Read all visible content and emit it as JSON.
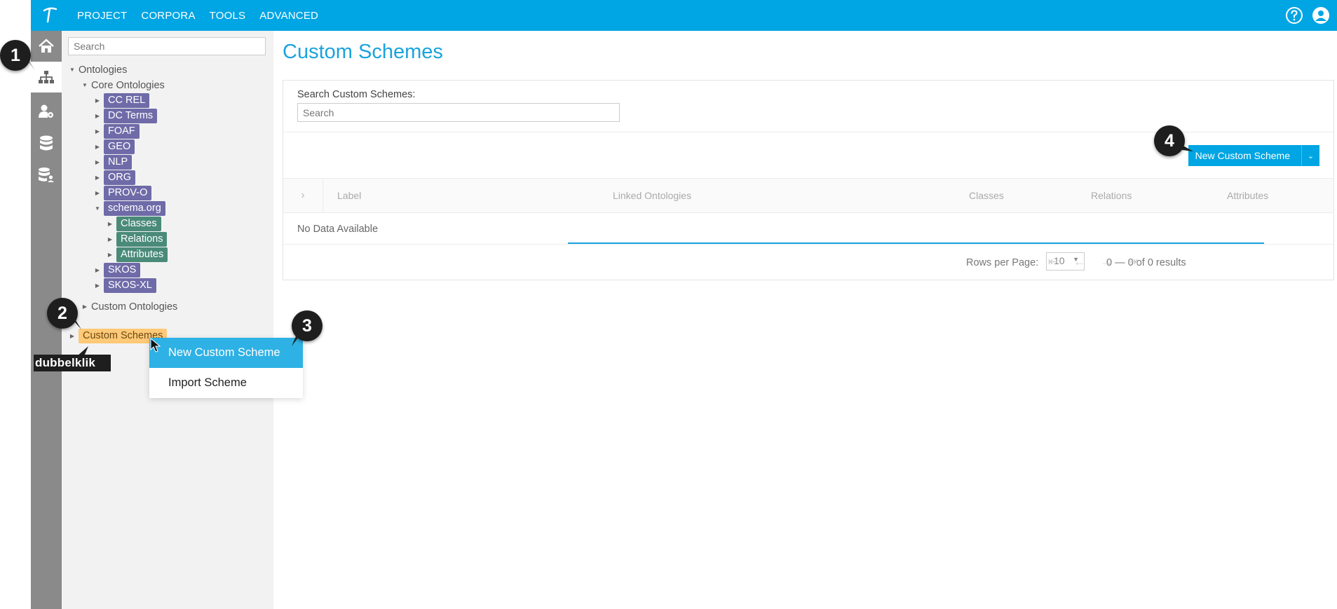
{
  "topbar": {
    "nav": [
      "PROJECT",
      "CORPORA",
      "TOOLS",
      "ADVANCED"
    ],
    "brand_color": "#00a5e3"
  },
  "sidebar": {
    "search_placeholder": "Search",
    "tree": {
      "ontologies": "Ontologies",
      "core_ontologies": "Core Ontologies",
      "core_items": [
        "CC REL",
        "DC Terms",
        "FOAF",
        "GEO",
        "NLP",
        "ORG",
        "PROV-O",
        "schema.org"
      ],
      "schema_children": [
        "Classes",
        "Relations",
        "Attributes"
      ],
      "more_items": [
        "SKOS",
        "SKOS-XL"
      ],
      "custom_ontologies": "Custom Ontologies",
      "custom_schemes": "Custom Schemes"
    }
  },
  "main": {
    "title": "Custom Schemes",
    "search_label": "Search Custom Schemes:",
    "search_placeholder": "Search",
    "new_button": "New Custom Scheme",
    "columns": [
      "Label",
      "Linked Ontologies",
      "Classes",
      "Relations",
      "Attributes"
    ],
    "empty": "No Data Available",
    "rows_per_page_label": "Rows per Page:",
    "rows_per_page": "10",
    "range": "0 — 0 of 0 results"
  },
  "context_menu": {
    "items": [
      "New Custom Scheme",
      "Import Scheme"
    ]
  },
  "annotations": {
    "badges": [
      "1",
      "2",
      "3",
      "4"
    ],
    "double_click": "dubbelklik"
  }
}
